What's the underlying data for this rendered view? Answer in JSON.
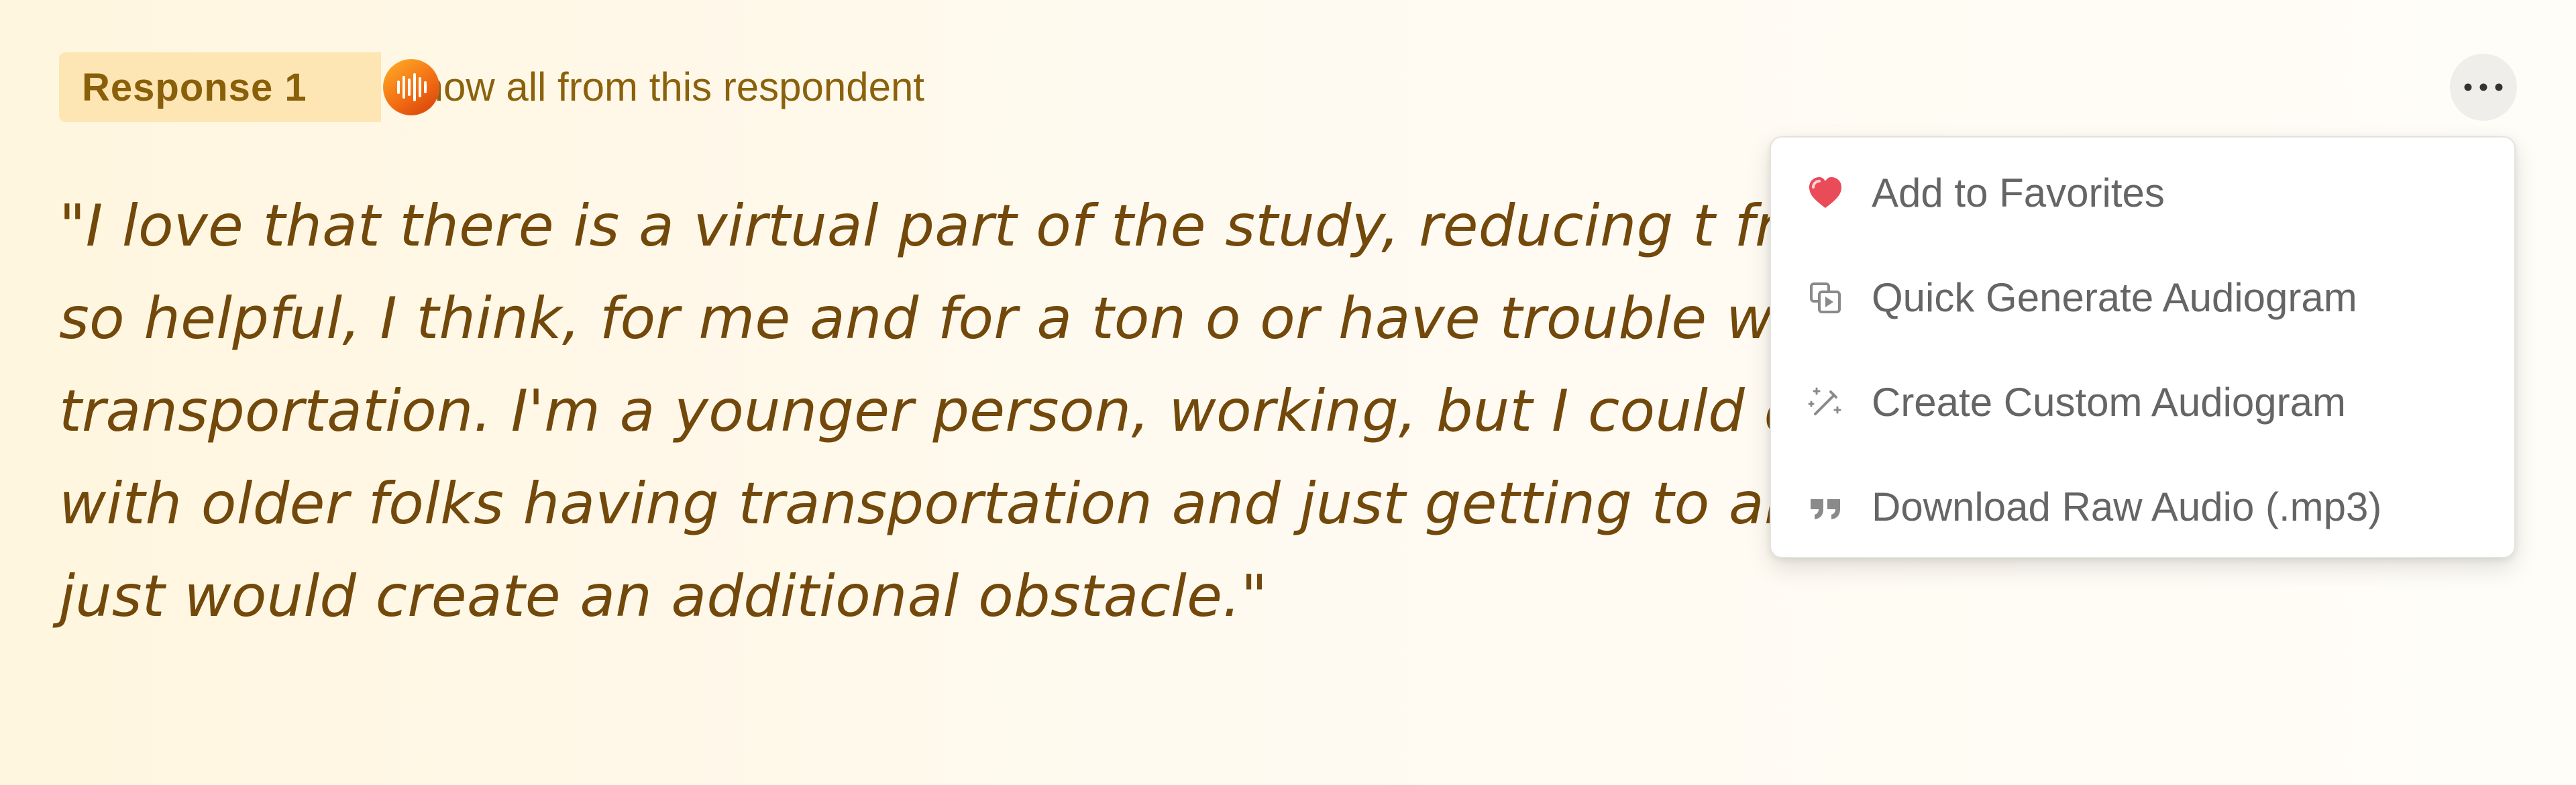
{
  "response": {
    "badge_label": "Response 1",
    "respondent_link": "Show all from this respondent",
    "quote": "\"I love that there is a virtual part of the study, reducing t from clinics. It is so helpful, I think, for me and for a ton o or have trouble with transportation. I'm a younger person, working, but I could definitely see with older folks having transportation and just getting to and from places, it just would create an additional obstacle.\""
  },
  "menu": {
    "items": [
      {
        "label": "Add to Favorites",
        "icon": "heart-icon"
      },
      {
        "label": "Quick Generate Audiogram",
        "icon": "audiogram-icon"
      },
      {
        "label": "Create Custom Audiogram",
        "icon": "magic-wand-icon"
      },
      {
        "label": "Download Raw Audio (.mp3)",
        "icon": "quote-icon"
      }
    ]
  },
  "icons": {
    "audio_indicator": "audio-wave-icon",
    "more": "more-options-icon"
  },
  "colors": {
    "background": "#fff6df",
    "badge": "#fde6b3",
    "accent_text": "#8a5f0a",
    "quote_text": "#72490b",
    "menu_text": "#656565",
    "heart": "#e94b59",
    "audio_gradient_start": "#ffb128",
    "audio_gradient_end": "#cf3e0b"
  }
}
